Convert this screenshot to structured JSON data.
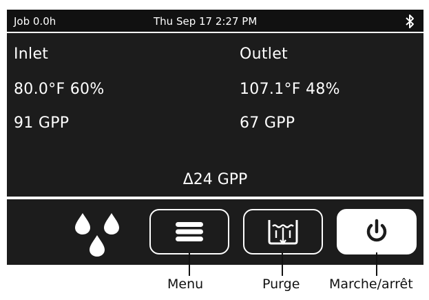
{
  "status_bar": {
    "job": "Job 0.0h",
    "datetime": "Thu Sep 17  2:27 PM",
    "bluetooth_icon": "bluetooth-icon"
  },
  "inlet": {
    "title": "Inlet",
    "temp_humidity": "80.0°F 60%",
    "gpp": "91 GPP"
  },
  "outlet": {
    "title": "Outlet",
    "temp_humidity": "107.1°F 48%",
    "gpp": "67 GPP"
  },
  "delta": "Δ24 GPP",
  "buttons": {
    "menu_icon": "menu-icon",
    "purge_icon": "purge-icon",
    "power_icon": "power-icon"
  },
  "callouts": {
    "menu": "Menu",
    "purge": "Purge",
    "power": "Marche/arrêt"
  },
  "colors": {
    "screen_bg": "#1c1c1c",
    "foreground": "#ffffff"
  }
}
